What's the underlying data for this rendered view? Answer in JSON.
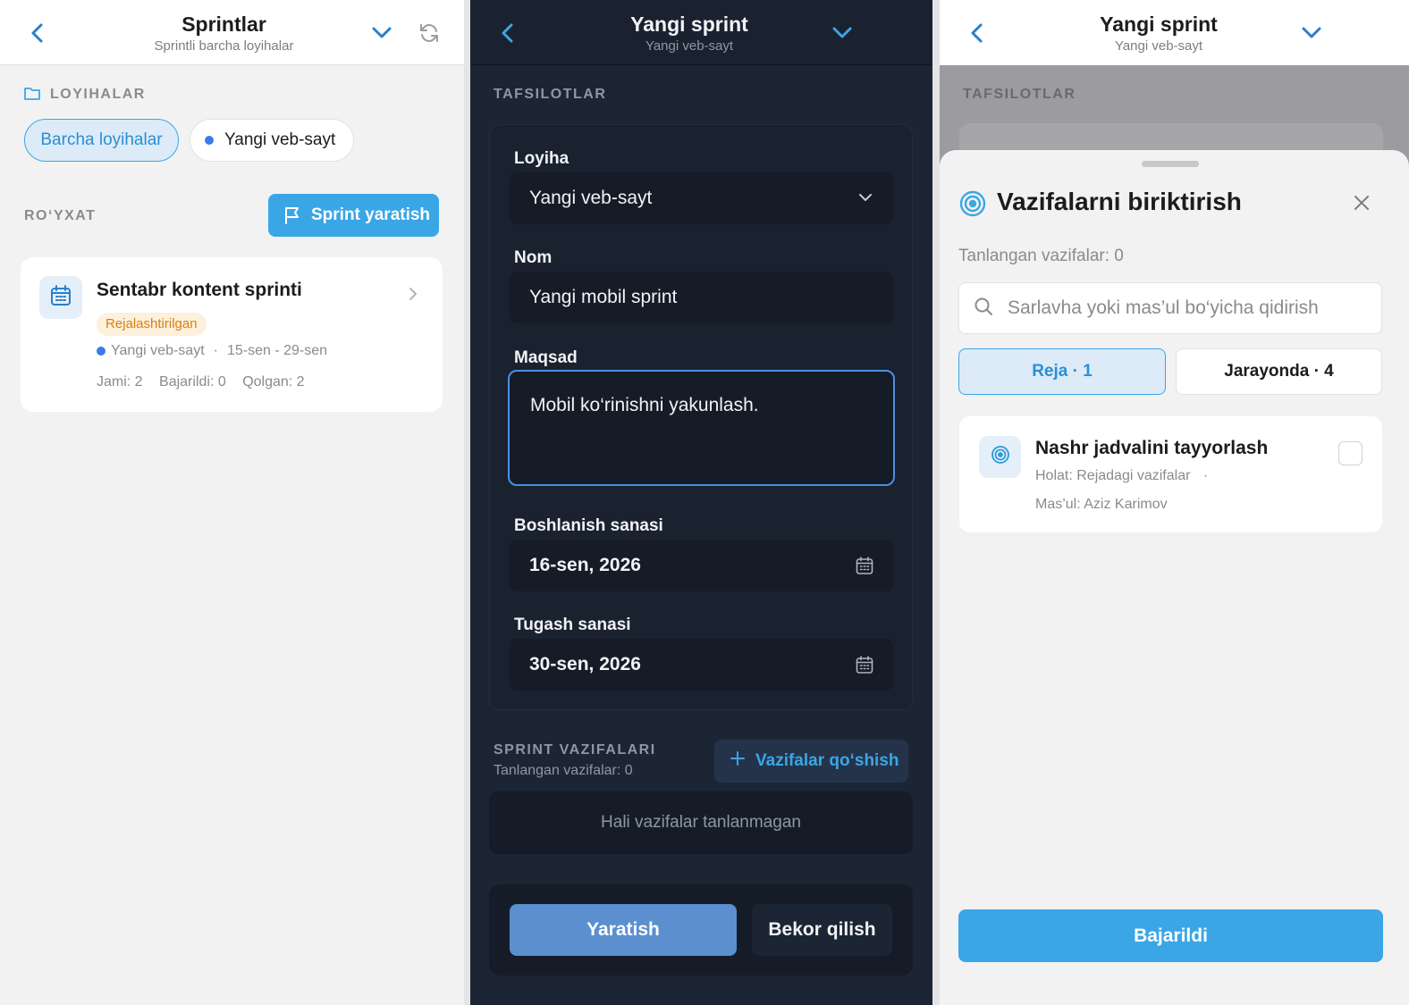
{
  "panel1": {
    "header": {
      "title": "Sprintlar",
      "subtitle": "Sprintli barcha loyihalar"
    },
    "projects_label": "LOYIHALAR",
    "chips": [
      "Barcha loyihalar",
      "Yangi veb-sayt"
    ],
    "list_label": "RO‘YXAT",
    "create_button": "Sprint yaratish",
    "sprint_card": {
      "title": "Sentabr kontent sprinti",
      "status": "Rejalashtirilgan",
      "project": "Yangi veb-sayt",
      "separator": "·",
      "dates": "15-sen - 29-sen",
      "total": "Jami: 2",
      "done": "Bajarildi: 0",
      "remaining": "Qolgan: 2"
    }
  },
  "panel2": {
    "header": {
      "title": "Yangi sprint",
      "subtitle": "Yangi veb-sayt"
    },
    "details_label": "TAFSILOTLAR",
    "project_label": "Loyiha",
    "project_value": "Yangi veb-sayt",
    "name_label": "Nom",
    "name_value": "Yangi mobil sprint",
    "goal_label": "Maqsad",
    "goal_value": "Mobil ko‘rinishni yakunlash.",
    "start_label": "Boshlanish sanasi",
    "start_value": "16-sen, 2026",
    "end_label": "Tugash sanasi",
    "end_value": "30-sen, 2026",
    "tasks_label": "SPRINT VAZIFALARI",
    "tasks_selected": "Tanlangan vazifalar: 0",
    "add_tasks_button": "Vazifalar qo‘shish",
    "empty_tasks": "Hali vazifalar tanlanmagan",
    "create_button": "Yaratish",
    "cancel_button": "Bekor qilish"
  },
  "panel3": {
    "header": {
      "title": "Yangi sprint",
      "subtitle": "Yangi veb-sayt"
    },
    "details_label": "TAFSILOTLAR",
    "sheet": {
      "title": "Vazifalarni biriktirish",
      "selected": "Tanlangan vazifalar: 0",
      "search_placeholder": "Sarlavha yoki mas’ul bo‘yicha qidirish",
      "tabs": [
        "Reja · 1",
        "Jarayonda · 4"
      ],
      "task": {
        "title": "Nashr jadvalini tayyorlash",
        "status": "Holat: Rejadagi vazifalar",
        "separator": "·",
        "assignee": "Mas’ul: Aziz Karimov",
        "checked": false
      },
      "done_button": "Bajarildi"
    }
  },
  "colors": {
    "accent": "#3aa6e6",
    "accent_dark": "#2a7fc9",
    "dark_bg": "#1c2533",
    "dark_field": "#151c28",
    "status_bg": "#fdf0dc",
    "status_text": "#d9800e"
  }
}
